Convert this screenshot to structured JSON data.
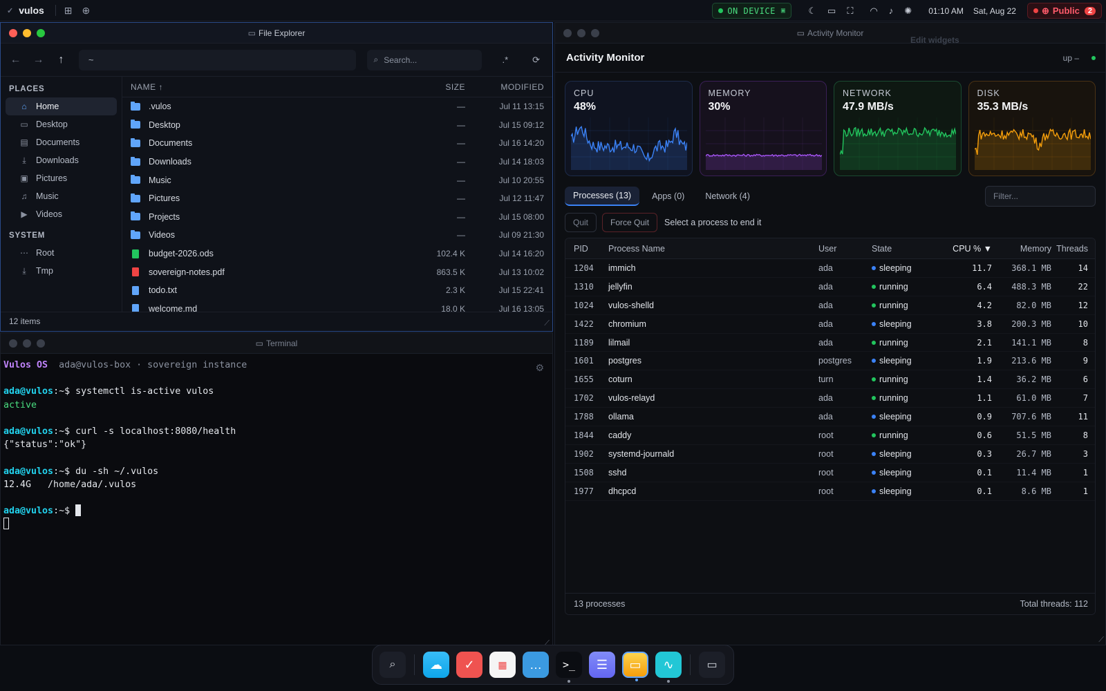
{
  "topbar": {
    "app_name": "vulos",
    "on_device": "ON DEVICE",
    "time": "01:10 AM",
    "date": "Sat, Aug 22",
    "public_label": "Public",
    "public_count": "2"
  },
  "file_explorer": {
    "title": "File Explorer",
    "path": "~",
    "search_placeholder": "Search...",
    "regex_btn": ".*",
    "places_heading": "PLACES",
    "places": [
      "Home",
      "Desktop",
      "Documents",
      "Downloads",
      "Pictures",
      "Music",
      "Videos"
    ],
    "system_heading": "SYSTEM",
    "system": [
      "Root",
      "Tmp"
    ],
    "columns": {
      "name": "NAME ↑",
      "size": "SIZE",
      "modified": "MODIFIED"
    },
    "files": [
      {
        "name": ".vulos",
        "size": "—",
        "modified": "Jul 11 13:15",
        "type": "folder"
      },
      {
        "name": "Desktop",
        "size": "—",
        "modified": "Jul 15 09:12",
        "type": "folder"
      },
      {
        "name": "Documents",
        "size": "—",
        "modified": "Jul 16 14:20",
        "type": "folder"
      },
      {
        "name": "Downloads",
        "size": "—",
        "modified": "Jul 14 18:03",
        "type": "folder"
      },
      {
        "name": "Music",
        "size": "—",
        "modified": "Jul 10 20:55",
        "type": "folder"
      },
      {
        "name": "Pictures",
        "size": "—",
        "modified": "Jul 12 11:47",
        "type": "folder"
      },
      {
        "name": "Projects",
        "size": "—",
        "modified": "Jul 15 08:00",
        "type": "folder"
      },
      {
        "name": "Videos",
        "size": "—",
        "modified": "Jul 09 21:30",
        "type": "folder"
      },
      {
        "name": "budget-2026.ods",
        "size": "102.4 K",
        "modified": "Jul 14 16:20",
        "type": "sheet"
      },
      {
        "name": "sovereign-notes.pdf",
        "size": "863.5 K",
        "modified": "Jul 13 10:02",
        "type": "pdf"
      },
      {
        "name": "todo.txt",
        "size": "2.3 K",
        "modified": "Jul 15 22:41",
        "type": "text"
      },
      {
        "name": "welcome.md",
        "size": "18.0 K",
        "modified": "Jul 16 13:05",
        "type": "text"
      }
    ],
    "status": "12 items"
  },
  "terminal": {
    "title": "Terminal",
    "banner_os": "Vulos OS",
    "banner_info": "ada@vulos-box · sovereign instance",
    "prompt_user": "ada@vulos",
    "prompt_sep": ":~$ ",
    "cmd1": "systemctl is-active vulos",
    "out1": "active",
    "cmd2": "curl -s localhost:8080/health",
    "out2": "{\"status\":\"ok\"}",
    "cmd3": "du -sh ~/.vulos",
    "out3": "12.4G   /home/ada/.vulos"
  },
  "activity_monitor": {
    "title": "Activity Monitor",
    "edit_widgets": "Edit widgets",
    "heading": "Activity Monitor",
    "uptime": "up –",
    "cards": [
      {
        "label": "CPU",
        "value": "48%",
        "color": "#3b82f6"
      },
      {
        "label": "MEMORY",
        "value": "30%",
        "color": "#a855f7"
      },
      {
        "label": "NETWORK",
        "value": "47.9 MB/s",
        "color": "#22c55e"
      },
      {
        "label": "DISK",
        "value": "35.3 MB/s",
        "color": "#f59e0b"
      }
    ],
    "tabs": [
      "Processes (13)",
      "Apps (0)",
      "Network (4)"
    ],
    "filter_placeholder": "Filter...",
    "quit": "Quit",
    "force_quit": "Force Quit",
    "hint": "Select a process to end it",
    "columns": {
      "pid": "PID",
      "name": "Process Name",
      "user": "User",
      "state": "State",
      "cpu": "CPU % ▼",
      "memory": "Memory",
      "threads": "Threads"
    },
    "processes": [
      {
        "pid": "1204",
        "name": "immich",
        "user": "ada",
        "state": "sleeping",
        "cpu": "11.7",
        "mem": "368.1 MB",
        "threads": "14"
      },
      {
        "pid": "1310",
        "name": "jellyfin",
        "user": "ada",
        "state": "running",
        "cpu": "6.4",
        "mem": "488.3 MB",
        "threads": "22"
      },
      {
        "pid": "1024",
        "name": "vulos-shelld",
        "user": "ada",
        "state": "running",
        "cpu": "4.2",
        "mem": "82.0 MB",
        "threads": "12"
      },
      {
        "pid": "1422",
        "name": "chromium",
        "user": "ada",
        "state": "sleeping",
        "cpu": "3.8",
        "mem": "200.3 MB",
        "threads": "10"
      },
      {
        "pid": "1189",
        "name": "lilmail",
        "user": "ada",
        "state": "running",
        "cpu": "2.1",
        "mem": "141.1 MB",
        "threads": "8"
      },
      {
        "pid": "1601",
        "name": "postgres",
        "user": "postgres",
        "state": "sleeping",
        "cpu": "1.9",
        "mem": "213.6 MB",
        "threads": "9"
      },
      {
        "pid": "1655",
        "name": "coturn",
        "user": "turn",
        "state": "running",
        "cpu": "1.4",
        "mem": "36.2 MB",
        "threads": "6"
      },
      {
        "pid": "1702",
        "name": "vulos-relayd",
        "user": "ada",
        "state": "running",
        "cpu": "1.1",
        "mem": "61.0 MB",
        "threads": "7"
      },
      {
        "pid": "1788",
        "name": "ollama",
        "user": "ada",
        "state": "sleeping",
        "cpu": "0.9",
        "mem": "707.6 MB",
        "threads": "11"
      },
      {
        "pid": "1844",
        "name": "caddy",
        "user": "root",
        "state": "running",
        "cpu": "0.6",
        "mem": "51.5 MB",
        "threads": "8"
      },
      {
        "pid": "1902",
        "name": "systemd-journald",
        "user": "root",
        "state": "sleeping",
        "cpu": "0.3",
        "mem": "26.7 MB",
        "threads": "3"
      },
      {
        "pid": "1508",
        "name": "sshd",
        "user": "root",
        "state": "sleeping",
        "cpu": "0.1",
        "mem": "11.4 MB",
        "threads": "1"
      },
      {
        "pid": "1977",
        "name": "dhcpcd",
        "user": "root",
        "state": "sleeping",
        "cpu": "0.1",
        "mem": "8.6 MB",
        "threads": "1"
      }
    ],
    "footer_count": "13 processes",
    "footer_threads": "Total threads: 112"
  },
  "colors": {
    "running": "#22c55e",
    "sleeping": "#3b82f6",
    "accent": "#3b82f6"
  },
  "dock": [
    "search-icon",
    "cloud-upload-icon",
    "pocket-icon",
    "calendar-icon",
    "chat-icon",
    "terminal-icon",
    "settings-icon",
    "files-icon",
    "activity-icon",
    "messages-icon"
  ]
}
